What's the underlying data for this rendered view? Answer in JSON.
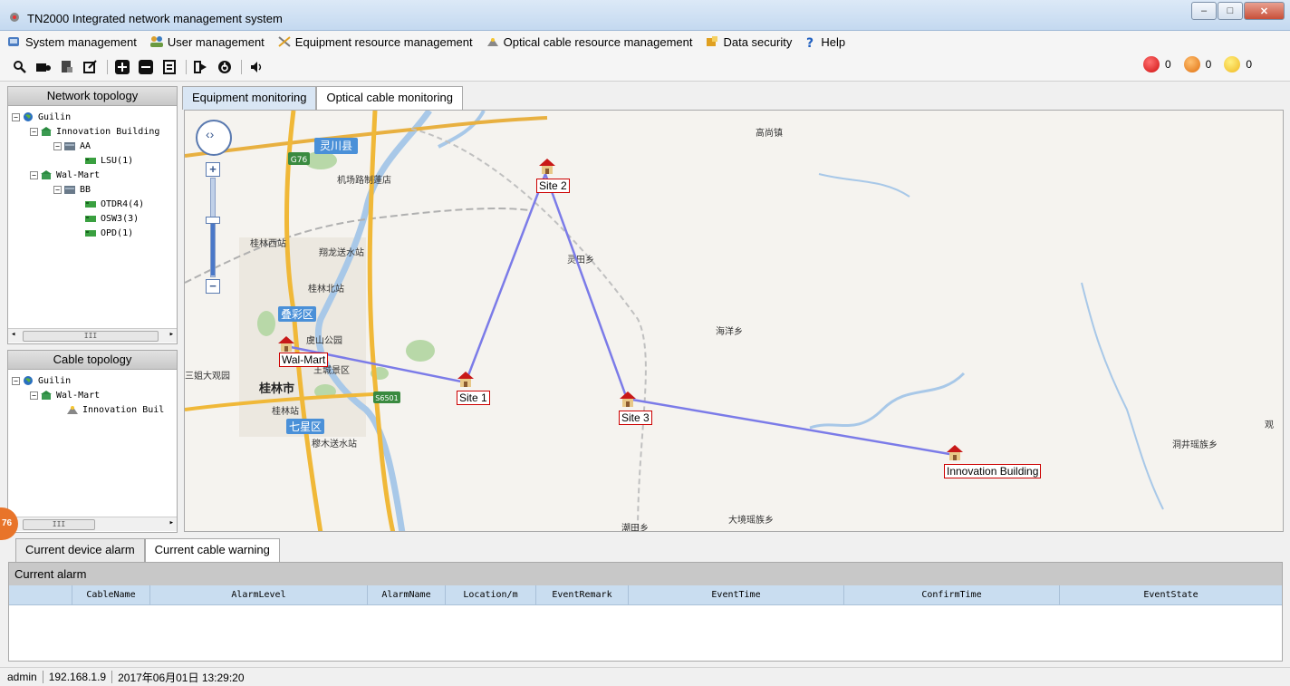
{
  "window": {
    "title": "TN2000  Integrated network management system"
  },
  "menu": [
    {
      "label": "System management",
      "icon": "system-icon"
    },
    {
      "label": "User management",
      "icon": "users-icon"
    },
    {
      "label": "Equipment resource management",
      "icon": "tools-icon"
    },
    {
      "label": "Optical cable resource management",
      "icon": "cable-icon"
    },
    {
      "label": "Data security",
      "icon": "security-icon"
    },
    {
      "label": "Help",
      "icon": "help-icon"
    }
  ],
  "alarms": {
    "red": "0",
    "orange": "0",
    "yellow": "0"
  },
  "colors": {
    "red": "#e02020",
    "orange": "#f08c1c",
    "yellow": "#f5c530",
    "link": "#7b7be8"
  },
  "network_topology": {
    "title": "Network topology",
    "nodes": [
      {
        "label": "Guilin"
      },
      {
        "label": "Innovation Building"
      },
      {
        "label": "AA"
      },
      {
        "label": "LSU(1)"
      },
      {
        "label": "Wal-Mart"
      },
      {
        "label": "BB"
      },
      {
        "label": "OTDR4(4)"
      },
      {
        "label": "OSW3(3)"
      },
      {
        "label": "OPD(1)"
      }
    ]
  },
  "cable_topology": {
    "title": "Cable topology",
    "nodes": [
      {
        "label": "Guilin"
      },
      {
        "label": "Wal-Mart"
      },
      {
        "label": "Innovation Buil"
      }
    ]
  },
  "tabs": {
    "equipment": "Equipment monitoring",
    "cable": "Optical cable monitoring"
  },
  "map": {
    "sites": [
      {
        "name": "Wal-Mart"
      },
      {
        "name": "Site 1"
      },
      {
        "name": "Site 2"
      },
      {
        "name": "Site 3"
      },
      {
        "name": "Innovation Building"
      }
    ],
    "places": [
      "高尚镇",
      "灵川县",
      "机场路制蓬店",
      "桂林西站",
      "翔龙送水站",
      "桂林北站",
      "叠彩区",
      "虞山公园",
      "灵田乡",
      "海洋乡",
      "三姐大观园",
      "王城景区",
      "桂林市",
      "桂林站",
      "七星区",
      "穆木送水站",
      "潮田乡",
      "大境瑶族乡",
      "洞井瑶族乡",
      "观",
      "G76",
      "S6501"
    ]
  },
  "bottom_tabs": {
    "device": "Current device alarm",
    "cable": "Current cable warning"
  },
  "alarm_table": {
    "title": "Current alarm",
    "columns": [
      "",
      "CableName",
      "AlarmLevel",
      "AlarmName",
      "Location/m",
      "EventRemark",
      "EventTime",
      "ConfirmTime",
      "EventState"
    ]
  },
  "status": {
    "user": "admin",
    "ip": "192.168.1.9",
    "datetime": "2017年06月01日 13:29:20"
  },
  "badge": "76",
  "scroll_thumb": "III"
}
